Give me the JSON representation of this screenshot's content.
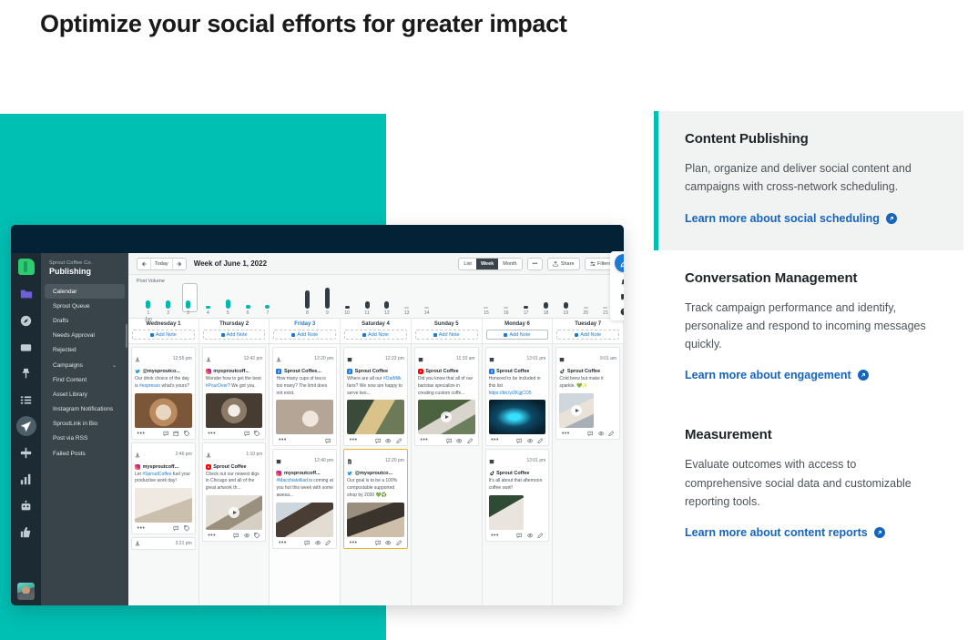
{
  "page": {
    "heading": "Optimize your social efforts for greater impact",
    "accent_teal": "#00bfb3",
    "link_blue": "#1565c0"
  },
  "info_sections": [
    {
      "title": "Content Publishing",
      "description": "Plan, organize and deliver social content and campaigns with cross-network scheduling.",
      "link": "Learn more about social scheduling",
      "highlighted": true
    },
    {
      "title": "Conversation Management",
      "description": "Track campaign performance and identify, personalize and respond to incoming messages quickly.",
      "link": "Learn more about engagement",
      "highlighted": false
    },
    {
      "title": "Measurement",
      "description": "Evaluate outcomes with access to comprehensive social data and customizable reporting tools.",
      "link": "Learn more about content reports",
      "highlighted": false
    }
  ],
  "app": {
    "rail_icons": [
      "folder-icon",
      "compass-icon",
      "inbox-icon",
      "pin-icon",
      "list-icon",
      "publish-icon",
      "pulse-icon",
      "bar-chart-icon",
      "robot-icon",
      "thumbs-up-icon"
    ],
    "nav": {
      "org": "Sprout Coffee Co.",
      "title": "Publishing",
      "items": [
        {
          "label": "Calendar",
          "active": true,
          "chevron": false
        },
        {
          "label": "Sprout Queue",
          "active": false,
          "chevron": false
        },
        {
          "label": "Drafts",
          "active": false,
          "chevron": false
        },
        {
          "label": "Needs Approval",
          "active": false,
          "chevron": false
        },
        {
          "label": "Rejected",
          "active": false,
          "chevron": false
        },
        {
          "label": "Campaigns",
          "active": false,
          "chevron": true
        },
        {
          "label": "Find Content",
          "active": false,
          "chevron": false
        },
        {
          "label": "Asset Library",
          "active": false,
          "chevron": false
        },
        {
          "label": "Instagram Notifications",
          "active": false,
          "chevron": false
        },
        {
          "label": "SproutLink in Bio",
          "active": false,
          "chevron": false
        },
        {
          "label": "Post via RSS",
          "active": false,
          "chevron": false
        },
        {
          "label": "Failed Posts",
          "active": false,
          "chevron": false
        }
      ]
    },
    "toolbar": {
      "today_label": "Today",
      "week_label": "Week of June 1, 2022",
      "views": [
        {
          "label": "List",
          "selected": false
        },
        {
          "label": "Week",
          "selected": true
        },
        {
          "label": "Month",
          "selected": false
        }
      ],
      "more_label": "•••",
      "share_label": "Share",
      "filters_label": "Filters"
    },
    "volume": {
      "title": "Post Volume",
      "month_label": "Jun",
      "close_icon": "close-icon"
    },
    "add_note_label": "Add Note",
    "days": [
      {
        "name": "Wednesday 1",
        "today": false
      },
      {
        "name": "Thursday 2",
        "today": false
      },
      {
        "name": "Friday 3",
        "today": true
      },
      {
        "name": "Saturday 4",
        "today": false
      },
      {
        "name": "Sunday 5",
        "today": false
      },
      {
        "name": "Monday 6",
        "today": false
      },
      {
        "name": "Tuesday 7",
        "today": false
      }
    ],
    "columns": [
      {
        "cards": [
          {
            "time": "12:55 pm",
            "network": "twitter",
            "account": "@mysproutco...",
            "text": "Our drink choice of the day is #espresso what's yours?",
            "link_text": "#espresso",
            "media": "latte-art",
            "video": false,
            "draft": false,
            "head_icon": "publish-icon",
            "actions": [
              "more",
              "comment",
              "calendar",
              "tag"
            ]
          },
          {
            "time": "2:46 pm",
            "network": "instagram",
            "account": "mysproutcoff...",
            "text": "Let #SproutCoffee fuel your productive work day!",
            "link_text": "#SproutCoffee",
            "media": "desk-coffee",
            "video": false,
            "draft": false,
            "head_icon": "publish-icon",
            "actions": [
              "more",
              "comment",
              "tag"
            ]
          },
          {
            "time": "3:21 pm",
            "stub": true,
            "head_icon": "publish-icon"
          }
        ]
      },
      {
        "cards": [
          {
            "time": "12:42 pm",
            "network": "instagram",
            "account": "mysproutcoff...",
            "text": "Wonder how to get the best #PourOver? We got you.",
            "link_text": "#PourOver",
            "media": "pour-over",
            "video": false,
            "draft": false,
            "head_icon": "publish-icon",
            "actions": [
              "more",
              "comment",
              "tag"
            ]
          },
          {
            "time": "1:10 pm",
            "network": "youtube",
            "account": "Sprout Coffee",
            "text": "Check out our newest digs in Chicago and all of the great artwork th...",
            "link_text": "",
            "media": "cafe-table",
            "video": true,
            "draft": false,
            "head_icon": "publish-icon",
            "actions": [
              "more",
              "comment",
              "eye",
              "tag"
            ]
          }
        ]
      },
      {
        "cards": [
          {
            "time": "12:20 pm",
            "network": "facebook",
            "account": "Sprout Coffee...",
            "text": "How many cups of tea is too many? The limit does not exist.",
            "link_text": "",
            "media": "tea-cup",
            "video": false,
            "draft": false,
            "head_icon": "publish-icon",
            "actions": [
              "more",
              "comment"
            ]
          },
          {
            "time": "12:40 pm",
            "network": "instagram",
            "account": "mysproutcoff...",
            "text": "#Macchiatolliad is coming at you hot this week with some awesa...",
            "link_text": "#Macchiatolliad",
            "media": "barista-pour",
            "video": false,
            "draft": false,
            "head_icon": "calendar-icon",
            "actions": [
              "more",
              "comment",
              "eye",
              "edit"
            ]
          }
        ]
      },
      {
        "cards": [
          {
            "time": "12:23 pm",
            "network": "facebook",
            "account": "Sprout Coffee",
            "text": "Where are all our #OatMilk fans? We now are happy to serve two...",
            "link_text": "#OatMilk",
            "media": "iced-drink",
            "video": false,
            "draft": false,
            "head_icon": "calendar-icon",
            "actions": [
              "more",
              "comment",
              "eye",
              "edit"
            ]
          },
          {
            "time": "12:20 pm",
            "network": "twitter",
            "account": "@mysproutco...",
            "text": "Our goal is to be a 100% compostable supported shop by 2030 💚♻️",
            "link_text": "",
            "media": "shop-interior",
            "video": false,
            "draft": true,
            "head_icon": "draft-icon",
            "actions": [
              "more",
              "comment",
              "eye",
              "edit"
            ]
          }
        ]
      },
      {
        "cards": [
          {
            "time": "11:33 am",
            "network": "youtube",
            "account": "Sprout Coffee",
            "text": "Did you know that all of our baristas specialize in creating custom coffe...",
            "link_text": "",
            "media": "hand-cup",
            "video": true,
            "draft": false,
            "head_icon": "calendar-icon",
            "actions": [
              "more",
              "comment",
              "eye",
              "edit"
            ]
          }
        ]
      },
      {
        "cards": [
          {
            "time": "12:01 pm",
            "network": "facebook",
            "account": "Sprout Coffee",
            "text": "Honored to be included in this list https://bit.ly/2KgjCO5",
            "link_text": "https://bit.ly/2KgjCO5",
            "media": "neon-sign",
            "video": false,
            "draft": false,
            "head_icon": "calendar-icon",
            "actions": [
              "more",
              "comment",
              "eye",
              "edit"
            ]
          },
          {
            "time": "12:01 pm",
            "network": "tiktok",
            "account": "Sprout Coffee",
            "text": "It's all about that afternoon coffee swirl!",
            "link_text": "",
            "media": "swirl-cup",
            "video": false,
            "draft": false,
            "head_icon": "calendar-icon",
            "small_media": true,
            "actions": [
              "more",
              "comment",
              "eye",
              "edit"
            ]
          }
        ]
      },
      {
        "cards": [
          {
            "time": "9:01 am",
            "network": "tiktok",
            "account": "Sprout Coffee",
            "text": "Cold brew but make it sparkle. 💚✨",
            "link_text": "",
            "media": "cold-brew",
            "video": true,
            "draft": false,
            "head_icon": "calendar-icon",
            "small_media": true,
            "actions": [
              "more",
              "comment",
              "eye",
              "edit"
            ]
          }
        ]
      }
    ]
  },
  "chart_data": {
    "type": "bar",
    "title": "Post Volume",
    "xlabel": "Jun",
    "ylabel": "",
    "grid": false,
    "legend": "none",
    "categories": [
      "1",
      "2",
      "3",
      "4",
      "5",
      "6",
      "7",
      "8",
      "9",
      "10",
      "11",
      "12",
      "13",
      "14",
      "15",
      "16",
      "17",
      "18",
      "19",
      "20",
      "21"
    ],
    "values": [
      9,
      9,
      9,
      2,
      10,
      4,
      4,
      20,
      23,
      2,
      8,
      8,
      0,
      0,
      0,
      0,
      3,
      7,
      7,
      0,
      0
    ],
    "colors": [
      "#00b7ae",
      "#00b7ae",
      "#00b7ae",
      "#00b7ae",
      "#00b7ae",
      "#00b7ae",
      "#00b7ae",
      "#2f3e46",
      "#2f3e46",
      "#2f3e46",
      "#2f3e46",
      "#2f3e46",
      "#2f3e46",
      "#2f3e46",
      "#2f3e46",
      "#2f3e46",
      "#2f3e46",
      "#2f3e46",
      "#2f3e46",
      "#2f3e46",
      "#2f3e46"
    ],
    "selected_category": "3",
    "ylim": [
      0,
      24
    ]
  }
}
